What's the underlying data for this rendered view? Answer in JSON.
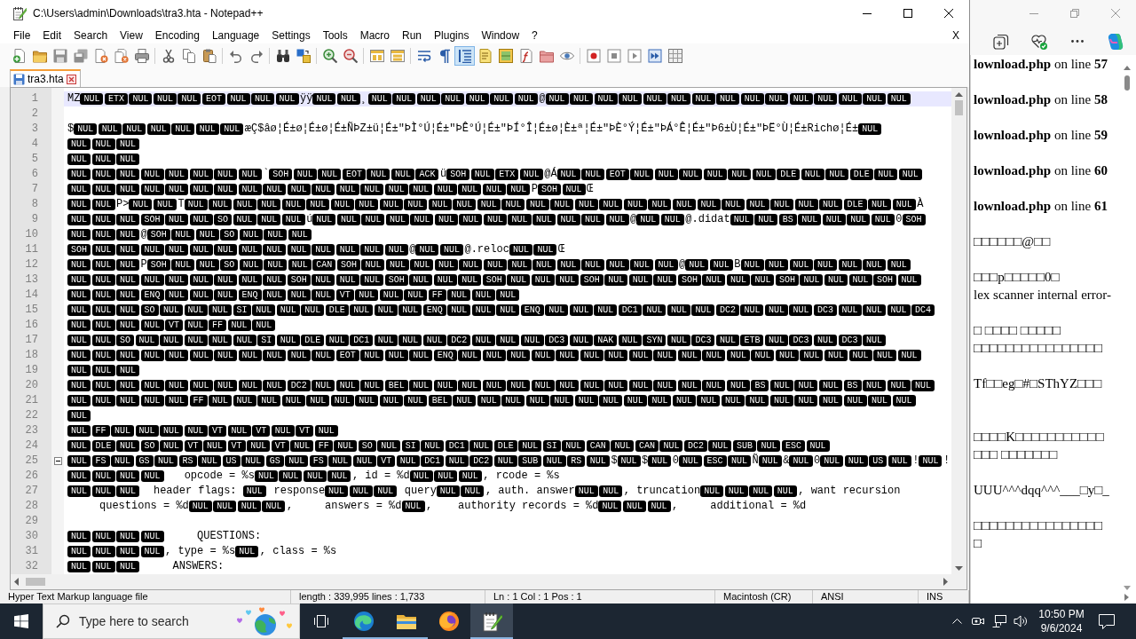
{
  "notepad": {
    "title": "C:\\Users\\admin\\Downloads\\tra3.hta - Notepad++",
    "menu": [
      "File",
      "Edit",
      "Search",
      "View",
      "Encoding",
      "Language",
      "Settings",
      "Tools",
      "Macro",
      "Run",
      "Plugins",
      "Window",
      "?"
    ],
    "menu_close": "X",
    "toolbar": [
      {
        "kind": "new",
        "pressed": false
      },
      {
        "kind": "open",
        "pressed": false
      },
      {
        "kind": "save",
        "pressed": false
      },
      {
        "kind": "save-all",
        "pressed": false
      },
      {
        "kind": "close",
        "pressed": false
      },
      {
        "kind": "close-all",
        "pressed": false
      },
      {
        "kind": "print",
        "pressed": false
      },
      {
        "kind": "separator"
      },
      {
        "kind": "cut",
        "pressed": false
      },
      {
        "kind": "copy",
        "pressed": false
      },
      {
        "kind": "paste",
        "pressed": false
      },
      {
        "kind": "separator"
      },
      {
        "kind": "undo",
        "pressed": false
      },
      {
        "kind": "redo",
        "pressed": false
      },
      {
        "kind": "separator"
      },
      {
        "kind": "find",
        "pressed": false
      },
      {
        "kind": "replace",
        "pressed": false
      },
      {
        "kind": "separator"
      },
      {
        "kind": "zoom-in",
        "pressed": false
      },
      {
        "kind": "zoom-out",
        "pressed": false
      },
      {
        "kind": "separator"
      },
      {
        "kind": "sync-vertical",
        "pressed": false
      },
      {
        "kind": "sync-horizontal",
        "pressed": false
      },
      {
        "kind": "separator"
      },
      {
        "kind": "word-wrap",
        "pressed": false
      },
      {
        "kind": "all-chars",
        "pressed": false
      },
      {
        "kind": "indent-guide",
        "pressed": true
      },
      {
        "kind": "language",
        "pressed": false
      },
      {
        "kind": "doc-map",
        "pressed": false
      },
      {
        "kind": "function-list",
        "pressed": false
      },
      {
        "kind": "folder-workspace",
        "pressed": false
      },
      {
        "kind": "monitoring",
        "pressed": false
      },
      {
        "kind": "separator"
      },
      {
        "kind": "record",
        "pressed": false
      },
      {
        "kind": "stop",
        "pressed": false
      },
      {
        "kind": "play",
        "pressed": false
      },
      {
        "kind": "play-multiple",
        "pressed": false
      },
      {
        "kind": "save-macro",
        "pressed": false
      }
    ],
    "tabs": [
      {
        "label": "tra3.hta",
        "selected": true,
        "modified": false
      }
    ],
    "editor": {
      "lines": [
        {
          "number": "1",
          "current": true,
          "fold_start": false,
          "segments": [
            {
              "kind": "text",
              "text": "MZ"
            },
            {
              "kind": "ctrl",
              "codes": [
                "NUL",
                "ETX",
                "NUL",
                "NUL",
                "NUL",
                "EOT",
                "NUL",
                "NUL",
                "NUL"
              ]
            },
            {
              "kind": "text",
              "text": "ÿÿ"
            },
            {
              "kind": "ctrl",
              "codes": [
                "NUL",
                "NUL"
              ]
            },
            {
              "kind": "text",
              "text": "¸"
            },
            {
              "kind": "ctrl",
              "codes": [
                "NUL",
                "NUL",
                "NUL",
                "NUL",
                "NUL",
                "NUL",
                "NUL"
              ]
            },
            {
              "kind": "text",
              "text": "@"
            },
            {
              "kind": "ctrl",
              "codes": [
                "NUL",
                "NUL",
                "NUL",
                "NUL",
                "NUL",
                "NUL",
                "NUL",
                "NUL",
                "NUL",
                "NUL",
                "NUL",
                "NUL",
                "NUL",
                "NUL",
                "NUL"
              ]
            }
          ]
        },
        {
          "number": "2",
          "current": false,
          "fold_start": false
        },
        {
          "number": "3",
          "current": false,
          "fold_start": false,
          "segments": [
            {
              "kind": "text",
              "text": "$"
            },
            {
              "kind": "ctrl",
              "codes": [
                "NUL",
                "NUL",
                "NUL",
                "NUL",
                "NUL",
                "NUL",
                "NUL"
              ]
            },
            {
              "kind": "text",
              "text": "æÇ$âø¦É±ø¦É±ø¦É±ÑÞZ±ü¦É±\"ÞÌ°Ú¦É±\"ÞÊ°Ú¦É±\"ÞÍ°Î¦É±ø¦È±ª¦É±\"ÞÈ°Ý¦É±\"ÞÁ°Ê¦É±\"Þ6±Ù¦É±\"ÞË°Ù¦É±Richø¦É±"
            },
            {
              "kind": "ctrl",
              "codes": [
                "NUL"
              ]
            }
          ]
        },
        {
          "number": "4",
          "current": false,
          "fold_start": false,
          "segments": [
            {
              "kind": "ctrl",
              "codes": [
                "NUL",
                "NUL",
                "NUL"
              ]
            }
          ]
        },
        {
          "number": "5",
          "current": false,
          "fold_start": false,
          "segments": [
            {
              "kind": "ctrl",
              "codes": [
                "NUL",
                "NUL",
                "NUL"
              ]
            }
          ]
        },
        {
          "number": "6",
          "current": false,
          "fold_start": false,
          "segments": [
            {
              "kind": "ctrl",
              "codes": [
                "NUL",
                "NUL",
                "NUL",
                "NUL",
                "NUL",
                "NUL",
                "NUL",
                "NUL"
              ]
            },
            {
              "kind": "text",
              "text": "`"
            },
            {
              "kind": "ctrl",
              "codes": [
                "SOH",
                "NUL",
                "NUL",
                "EOT",
                "NUL",
                "NUL",
                "ACK"
              ]
            },
            {
              "kind": "text",
              "text": "ü"
            },
            {
              "kind": "ctrl",
              "codes": [
                "SOH",
                "NUL",
                "ETX",
                "NUL"
              ]
            },
            {
              "kind": "text",
              "text": "@Á"
            },
            {
              "kind": "ctrl",
              "codes": [
                "NUL",
                "NUL",
                "EOT",
                "NUL",
                "NUL",
                "NUL",
                "NUL",
                "NUL",
                "NUL",
                "DLE",
                "NUL",
                "NUL",
                "DLE",
                "NUL",
                "NUL"
              ]
            }
          ]
        },
        {
          "number": "7",
          "current": false,
          "fold_start": false,
          "segments": [
            {
              "kind": "ctrl",
              "codes": [
                "NUL",
                "NUL",
                "NUL",
                "NUL",
                "NUL",
                "NUL",
                "NUL",
                "NUL",
                "NUL",
                "NUL",
                "NUL",
                "NUL",
                "NUL",
                "NUL",
                "NUL",
                "NUL",
                "NUL",
                "NUL",
                "NUL"
              ]
            },
            {
              "kind": "text",
              "text": "P"
            },
            {
              "kind": "ctrl",
              "codes": [
                "SOH",
                "NUL"
              ]
            },
            {
              "kind": "text",
              "text": "Œ"
            }
          ]
        },
        {
          "number": "8",
          "current": false,
          "fold_start": false,
          "segments": [
            {
              "kind": "ctrl",
              "codes": [
                "NUL",
                "NUL"
              ]
            },
            {
              "kind": "text",
              "text": "P>"
            },
            {
              "kind": "ctrl",
              "codes": [
                "NUL",
                "NUL"
              ]
            },
            {
              "kind": "text",
              "text": "T"
            },
            {
              "kind": "ctrl",
              "codes": [
                "NUL",
                "NUL",
                "NUL",
                "NUL",
                "NUL",
                "NUL",
                "NUL",
                "NUL",
                "NUL",
                "NUL",
                "NUL",
                "NUL",
                "NUL",
                "NUL",
                "NUL",
                "NUL",
                "NUL",
                "NUL",
                "NUL",
                "NUL",
                "NUL",
                "NUL",
                "NUL",
                "NUL",
                "NUL",
                "NUL",
                "NUL",
                "DLE",
                "NUL",
                "NUL"
              ]
            },
            {
              "kind": "text",
              "text": "À"
            }
          ]
        },
        {
          "number": "9",
          "current": false,
          "fold_start": false,
          "segments": [
            {
              "kind": "ctrl",
              "codes": [
                "NUL",
                "NUL",
                "NUL",
                "SOH",
                "NUL",
                "NUL",
                "SO",
                "NUL",
                "NUL",
                "NUL"
              ]
            },
            {
              "kind": "text",
              "text": "ú"
            },
            {
              "kind": "ctrl",
              "codes": [
                "NUL",
                "NUL",
                "NUL",
                "NUL",
                "NUL",
                "NUL",
                "NUL",
                "NUL",
                "NUL",
                "NUL",
                "NUL",
                "NUL",
                "NUL"
              ]
            },
            {
              "kind": "text",
              "text": "@"
            },
            {
              "kind": "ctrl",
              "codes": [
                "NUL",
                "NUL"
              ]
            },
            {
              "kind": "text",
              "text": "@.didat"
            },
            {
              "kind": "ctrl",
              "codes": [
                "NUL",
                "NUL",
                "BS",
                "NUL",
                "NUL",
                "NUL",
                "NUL"
              ]
            },
            {
              "kind": "text",
              "text": "0"
            },
            {
              "kind": "ctrl",
              "codes": [
                "SOH"
              ]
            }
          ]
        },
        {
          "number": "10",
          "current": false,
          "fold_start": false,
          "segments": [
            {
              "kind": "ctrl",
              "codes": [
                "NUL",
                "NUL",
                "NUL"
              ]
            },
            {
              "kind": "text",
              "text": "@"
            },
            {
              "kind": "ctrl",
              "codes": [
                "SOH",
                "NUL",
                "NUL",
                "SO",
                "NUL",
                "NUL",
                "NUL"
              ]
            }
          ]
        },
        {
          "number": "11",
          "current": false,
          "fold_start": false,
          "segments": [
            {
              "kind": "ctrl",
              "codes": [
                "SOH",
                "NUL",
                "NUL",
                "NUL",
                "NUL",
                "NUL",
                "NUL",
                "NUL",
                "NUL",
                "NUL",
                "NUL",
                "NUL",
                "NUL",
                "NUL"
              ]
            },
            {
              "kind": "text",
              "text": "@"
            },
            {
              "kind": "ctrl",
              "codes": [
                "NUL",
                "NUL"
              ]
            },
            {
              "kind": "text",
              "text": "@.reloc"
            },
            {
              "kind": "ctrl",
              "codes": [
                "NUL",
                "NUL"
              ]
            },
            {
              "kind": "text",
              "text": "Œ"
            }
          ]
        },
        {
          "number": "12",
          "current": false,
          "fold_start": false,
          "segments": [
            {
              "kind": "ctrl",
              "codes": [
                "NUL",
                "NUL",
                "NUL"
              ]
            },
            {
              "kind": "text",
              "text": "P"
            },
            {
              "kind": "ctrl",
              "codes": [
                "SOH",
                "NUL",
                "NUL",
                "SO",
                "NUL",
                "NUL",
                "NUL",
                "CAN",
                "SOH",
                "NUL",
                "NUL",
                "NUL",
                "NUL",
                "NUL",
                "NUL",
                "NUL",
                "NUL",
                "NUL",
                "NUL",
                "NUL",
                "NUL",
                "NUL"
              ]
            },
            {
              "kind": "text",
              "text": "@"
            },
            {
              "kind": "ctrl",
              "codes": [
                "NUL",
                "NUL"
              ]
            },
            {
              "kind": "text",
              "text": "B"
            },
            {
              "kind": "ctrl",
              "codes": [
                "NUL",
                "NUL",
                "NUL",
                "NUL",
                "NUL",
                "NUL",
                "NUL"
              ]
            }
          ]
        },
        {
          "number": "13",
          "current": false,
          "fold_start": false,
          "segments": [
            {
              "kind": "ctrl",
              "codes": [
                "NUL",
                "NUL",
                "NUL",
                "NUL",
                "NUL",
                "NUL",
                "NUL",
                "NUL",
                "NUL",
                "SOH",
                "NUL",
                "NUL",
                "NUL",
                "SOH",
                "NUL",
                "NUL",
                "NUL",
                "SOH",
                "NUL",
                "NUL",
                "NUL",
                "SOH",
                "NUL",
                "NUL",
                "NUL",
                "SOH",
                "NUL",
                "NUL",
                "NUL",
                "SOH",
                "NUL",
                "NUL",
                "NUL",
                "SOH",
                "NUL"
              ]
            }
          ]
        },
        {
          "number": "14",
          "current": false,
          "fold_start": false,
          "segments": [
            {
              "kind": "ctrl",
              "codes": [
                "NUL",
                "NUL",
                "NUL",
                "ENQ",
                "NUL",
                "NUL",
                "NUL",
                "ENQ",
                "NUL",
                "NUL",
                "NUL",
                "VT",
                "NUL",
                "NUL",
                "NUL",
                "FF",
                "NUL",
                "NUL",
                "NUL"
              ]
            }
          ]
        },
        {
          "number": "15",
          "current": false,
          "fold_start": false,
          "segments": [
            {
              "kind": "ctrl",
              "codes": [
                "NUL",
                "NUL",
                "NUL",
                "SO",
                "NUL",
                "NUL",
                "NUL",
                "SI",
                "NUL",
                "NUL",
                "NUL",
                "DLE",
                "NUL",
                "NUL",
                "NUL",
                "ENQ",
                "NUL",
                "NUL",
                "NUL",
                "ENQ",
                "NUL",
                "NUL",
                "NUL",
                "DC1",
                "NUL",
                "NUL",
                "NUL",
                "DC2",
                "NUL",
                "NUL",
                "NUL",
                "DC3",
                "NUL",
                "NUL",
                "NUL",
                "DC4"
              ]
            }
          ]
        },
        {
          "number": "16",
          "current": false,
          "fold_start": false,
          "segments": [
            {
              "kind": "ctrl",
              "codes": [
                "NUL",
                "NUL",
                "NUL",
                "NUL",
                "VT",
                "NUL",
                "FF",
                "NUL",
                "NUL"
              ]
            }
          ]
        },
        {
          "number": "17",
          "current": false,
          "fold_start": false,
          "segments": [
            {
              "kind": "ctrl",
              "codes": [
                "NUL",
                "NUL",
                "SO",
                "NUL",
                "NUL",
                "NUL",
                "NUL",
                "NUL",
                "SI",
                "NUL",
                "DLE",
                "NUL",
                "DC1",
                "NUL",
                "NUL",
                "NUL",
                "DC2",
                "NUL",
                "NUL",
                "NUL",
                "DC3",
                "NUL",
                "NAK",
                "NUL",
                "SYN",
                "NUL",
                "DC3",
                "NUL",
                "ETB",
                "NUL",
                "DC3",
                "NUL",
                "DC3",
                "NUL"
              ]
            }
          ]
        },
        {
          "number": "18",
          "current": false,
          "fold_start": false,
          "segments": [
            {
              "kind": "ctrl",
              "codes": [
                "NUL",
                "NUL",
                "NUL",
                "NUL",
                "NUL",
                "NUL",
                "NUL",
                "NUL",
                "NUL",
                "NUL",
                "NUL",
                "EOT",
                "NUL",
                "NUL",
                "NUL",
                "ENQ",
                "NUL",
                "NUL",
                "NUL",
                "NUL",
                "NUL",
                "NUL",
                "NUL",
                "NUL",
                "NUL",
                "NUL",
                "NUL",
                "NUL",
                "NUL",
                "NUL",
                "NUL",
                "NUL",
                "NUL",
                "NUL",
                "NUL"
              ]
            }
          ]
        },
        {
          "number": "19",
          "current": false,
          "fold_start": false,
          "segments": [
            {
              "kind": "ctrl",
              "codes": [
                "NUL",
                "NUL",
                "NUL"
              ]
            }
          ]
        },
        {
          "number": "20",
          "current": false,
          "fold_start": false,
          "segments": [
            {
              "kind": "ctrl",
              "codes": [
                "NUL",
                "NUL",
                "NUL",
                "NUL",
                "NUL",
                "NUL",
                "NUL",
                "NUL",
                "NUL",
                "DC2",
                "NUL",
                "NUL",
                "NUL",
                "BEL",
                "NUL",
                "NUL",
                "NUL",
                "NUL",
                "NUL",
                "NUL",
                "NUL",
                "NUL",
                "NUL",
                "NUL",
                "NUL",
                "NUL",
                "NUL",
                "NUL",
                "BS",
                "NUL",
                "NUL",
                "NUL",
                "BS",
                "NUL",
                "NUL",
                "NUL"
              ]
            }
          ]
        },
        {
          "number": "21",
          "current": false,
          "fold_start": false,
          "segments": [
            {
              "kind": "ctrl",
              "codes": [
                "NUL",
                "NUL",
                "NUL",
                "NUL",
                "NUL",
                "FF",
                "NUL",
                "NUL",
                "NUL",
                "NUL",
                "NUL",
                "NUL",
                "NUL",
                "NUL",
                "NUL",
                "BEL",
                "NUL",
                "NUL",
                "NUL",
                "NUL",
                "NUL",
                "NUL",
                "NUL",
                "NUL",
                "NUL",
                "NUL",
                "NUL",
                "NUL",
                "NUL",
                "NUL",
                "NUL",
                "NUL",
                "NUL",
                "NUL",
                "NUL"
              ]
            }
          ]
        },
        {
          "number": "22",
          "current": false,
          "fold_start": false,
          "segments": [
            {
              "kind": "ctrl",
              "codes": [
                "NUL"
              ]
            }
          ]
        },
        {
          "number": "23",
          "current": false,
          "fold_start": false,
          "segments": [
            {
              "kind": "ctrl",
              "codes": [
                "NUL",
                "FF",
                "NUL",
                "NUL",
                "NUL",
                "NUL",
                "VT",
                "NUL",
                "VT",
                "NUL",
                "VT",
                "NUL"
              ]
            }
          ]
        },
        {
          "number": "24",
          "current": false,
          "fold_start": false,
          "segments": [
            {
              "kind": "ctrl",
              "codes": [
                "NUL",
                "DLE",
                "NUL",
                "SO",
                "NUL",
                "VT",
                "NUL",
                "VT",
                "NUL",
                "VT",
                "NUL",
                "FF",
                "NUL",
                "SO",
                "NUL",
                "SI",
                "NUL",
                "DC1",
                "NUL",
                "DLE",
                "NUL",
                "SI",
                "NUL",
                "CAN",
                "NUL",
                "CAN",
                "NUL",
                "DC2",
                "NUL",
                "SUB",
                "NUL",
                "ESC",
                "NUL"
              ]
            }
          ]
        },
        {
          "number": "25",
          "current": false,
          "fold_start": true,
          "segments": [
            {
              "kind": "ctrl",
              "codes": [
                "NUL",
                "FS",
                "NUL",
                "GS",
                "NUL",
                "RS",
                "NUL",
                "US",
                "NUL",
                "GS",
                "NUL",
                "FS",
                "NUL",
                "NUL",
                "VT",
                "NUL",
                "DC1",
                "NUL",
                "DC2",
                "NUL",
                "SUB",
                "NUL",
                "RS",
                "NUL"
              ]
            },
            {
              "kind": "text",
              "text": "$"
            },
            {
              "kind": "ctrl",
              "codes": [
                "NUL"
              ]
            },
            {
              "kind": "text",
              "text": "$"
            },
            {
              "kind": "ctrl",
              "codes": [
                "NUL"
              ]
            },
            {
              "kind": "text",
              "text": "0"
            },
            {
              "kind": "ctrl",
              "codes": [
                "NUL",
                "ESC",
                "NUL"
              ]
            },
            {
              "kind": "text",
              "text": "Ñ"
            },
            {
              "kind": "ctrl",
              "codes": [
                "NUL"
              ]
            },
            {
              "kind": "text",
              "text": "&"
            },
            {
              "kind": "ctrl",
              "codes": [
                "NUL"
              ]
            },
            {
              "kind": "text",
              "text": "0"
            },
            {
              "kind": "ctrl",
              "codes": [
                "NUL",
                "NUL",
                "US",
                "NUL"
              ]
            },
            {
              "kind": "text",
              "text": "!"
            },
            {
              "kind": "ctrl",
              "codes": [
                "NUL"
              ]
            },
            {
              "kind": "text",
              "text": "!"
            }
          ]
        },
        {
          "number": "26",
          "current": false,
          "fold_start": false,
          "segments": [
            {
              "kind": "ctrl",
              "codes": [
                "NUL",
                "NUL",
                "NUL",
                "NUL"
              ]
            },
            {
              "kind": "text",
              "text": "   opcode = %s"
            },
            {
              "kind": "ctrl",
              "codes": [
                "NUL",
                "NUL",
                "NUL",
                "NUL"
              ]
            },
            {
              "kind": "text",
              "text": ", id = %d"
            },
            {
              "kind": "ctrl",
              "codes": [
                "NUL",
                "NUL",
                "NUL"
              ]
            },
            {
              "kind": "text",
              "text": ", rcode = %s"
            }
          ]
        },
        {
          "number": "27",
          "current": false,
          "fold_start": false,
          "segments": [
            {
              "kind": "ctrl",
              "codes": [
                "NUL",
                "NUL",
                "NUL"
              ]
            },
            {
              "kind": "text",
              "text": "  header flags: "
            },
            {
              "kind": "ctrl",
              "codes": [
                "NUL"
              ]
            },
            {
              "kind": "text",
              "text": " response"
            },
            {
              "kind": "ctrl",
              "codes": [
                "NUL",
                "NUL",
                "NUL"
              ]
            },
            {
              "kind": "text",
              "text": " query"
            },
            {
              "kind": "ctrl",
              "codes": [
                "NUL",
                "NUL"
              ]
            },
            {
              "kind": "text",
              "text": ", auth. answer"
            },
            {
              "kind": "ctrl",
              "codes": [
                "NUL",
                "NUL"
              ]
            },
            {
              "kind": "text",
              "text": ", truncation"
            },
            {
              "kind": "ctrl",
              "codes": [
                "NUL",
                "NUL",
                "NUL",
                "NUL"
              ]
            },
            {
              "kind": "text",
              "text": ", want recursion"
            }
          ]
        },
        {
          "number": "28",
          "current": false,
          "fold_start": false,
          "segments": [
            {
              "kind": "text",
              "text": "     questions = %d"
            },
            {
              "kind": "ctrl",
              "codes": [
                "NUL",
                "NUL",
                "NUL",
                "NUL"
              ]
            },
            {
              "kind": "text",
              "text": ",     answers = %d"
            },
            {
              "kind": "ctrl",
              "codes": [
                "NUL"
              ]
            },
            {
              "kind": "text",
              "text": ",    authority records = %d"
            },
            {
              "kind": "ctrl",
              "codes": [
                "NUL",
                "NUL",
                "NUL"
              ]
            },
            {
              "kind": "text",
              "text": ",     additional = %d"
            }
          ]
        },
        {
          "number": "29",
          "current": false,
          "fold_start": false
        },
        {
          "number": "30",
          "current": false,
          "fold_start": false,
          "segments": [
            {
              "kind": "ctrl",
              "codes": [
                "NUL",
                "NUL",
                "NUL",
                "NUL"
              ]
            },
            {
              "kind": "text",
              "text": "     QUESTIONS:"
            }
          ]
        },
        {
          "number": "31",
          "current": false,
          "fold_start": false,
          "segments": [
            {
              "kind": "ctrl",
              "codes": [
                "NUL",
                "NUL",
                "NUL",
                "NUL"
              ]
            },
            {
              "kind": "text",
              "text": ", type = %s"
            },
            {
              "kind": "ctrl",
              "codes": [
                "NUL"
              ]
            },
            {
              "kind": "text",
              "text": ", class = %s"
            }
          ]
        },
        {
          "number": "32",
          "current": false,
          "fold_start": false,
          "segments": [
            {
              "kind": "ctrl",
              "codes": [
                "NUL",
                "NUL",
                "NUL"
              ]
            },
            {
              "kind": "text",
              "text": "     ANSWERS:"
            }
          ]
        }
      ]
    },
    "status_bar": [
      "Hyper Text Markup language file",
      "length : 339,995    lines : 1,733",
      "Ln : 1    Col : 1    Pos : 1",
      "Macintosh (CR)",
      "ANSI",
      "INS"
    ]
  },
  "browser": {
    "paragraphs": [
      {
        "lines": [
          {
            "kind": "error",
            "text": "**lownload.php** on line **57**"
          }
        ]
      },
      {
        "lines": [
          {
            "kind": "error",
            "text": "**lownload.php** on line **58**"
          }
        ]
      },
      {
        "lines": [
          {
            "kind": "error",
            "text": "**lownload.php** on line **59**"
          }
        ]
      },
      {
        "lines": [
          {
            "kind": "error",
            "text": "**lownload.php** on line **60**"
          }
        ]
      },
      {
        "lines": [
          {
            "kind": "error",
            "text": "**lownload.php** on line **61**"
          }
        ]
      },
      {
        "lines": [
          {
            "kind": "text",
            "text": "□□□□□□@□□"
          }
        ]
      },
      {
        "lines": [
          {
            "kind": "text",
            "text": "□□□p□□□□□0□"
          },
          {
            "kind": "text",
            "text": "lex scanner internal error-"
          }
        ]
      },
      {
        "lines": [
          {
            "kind": "text",
            "text": "□ □□□□ □□□□□"
          },
          {
            "kind": "text",
            "text": "□□□□□□□□□□□□□□□□"
          }
        ]
      },
      {
        "lines": [
          {
            "kind": "text",
            "text": "Tf□□eg□#□SThYZ□□□"
          }
        ]
      },
      {
        "lines": [
          {
            "kind": "text",
            "text": "□□□□K□□□□□□□□□□□"
          },
          {
            "kind": "text",
            "text": "□□□ □□□□□□□"
          }
        ]
      },
      {
        "lines": [
          {
            "kind": "text",
            "text": "UUU^^^dqq^^^___□y□_"
          }
        ]
      },
      {
        "lines": [
          {
            "kind": "text",
            "text": "□□□□□□□□□□□□□□□□"
          },
          {
            "kind": "text",
            "text": "□"
          }
        ]
      }
    ]
  },
  "taskbar": {
    "search_placeholder": "Type here to search",
    "apps": [
      {
        "kind": "edge",
        "running": true,
        "selected": false
      },
      {
        "kind": "explorer",
        "running": true,
        "selected": false
      },
      {
        "kind": "firefox",
        "running": false,
        "selected": false
      },
      {
        "kind": "notepad",
        "running": true,
        "selected": true
      }
    ],
    "time": "10:50 PM",
    "date": "9/6/2024"
  }
}
